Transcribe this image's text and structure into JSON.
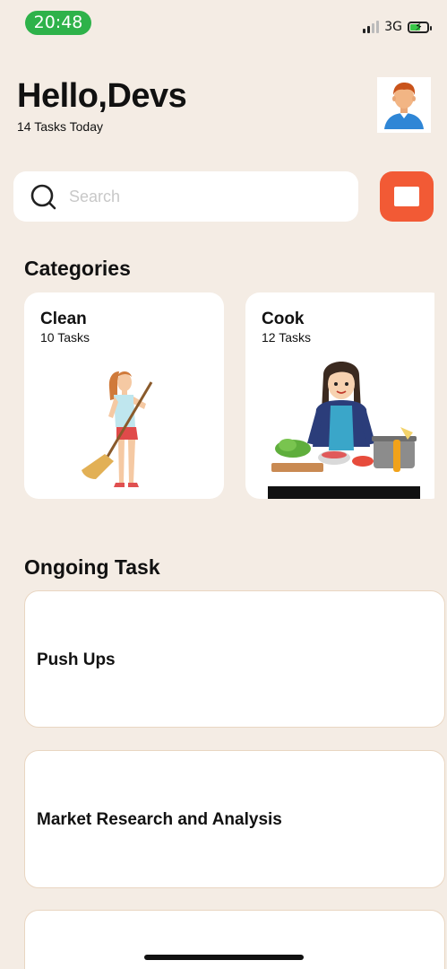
{
  "status_bar": {
    "time": "20:48",
    "network": "3G",
    "time_badge_color": "#2eb24a",
    "battery_charging": true
  },
  "header": {
    "greeting": "Hello,Devs",
    "subtitle": "14 Tasks Today",
    "avatar_icon": "person-avatar-icon"
  },
  "search": {
    "placeholder": "Search",
    "value": "",
    "icon": "search-icon"
  },
  "filter_button": {
    "icon": "square-icon",
    "color": "#f25a35"
  },
  "categories": {
    "title": "Categories",
    "items": [
      {
        "name": "Clean",
        "count": "10 Tasks",
        "illustration": "woman-sweeping-illustration"
      },
      {
        "name": "Cook",
        "count": "12 Tasks",
        "illustration": "woman-cooking-illustration"
      }
    ]
  },
  "ongoing": {
    "title": "Ongoing Task",
    "tasks": [
      {
        "title": "Push Ups"
      },
      {
        "title": "Market Research and Analysis"
      },
      {
        "title": ""
      }
    ]
  },
  "colors": {
    "background": "#f4ece4",
    "card": "#ffffff",
    "task_border": "#e9d6c2",
    "accent": "#f25a35"
  }
}
